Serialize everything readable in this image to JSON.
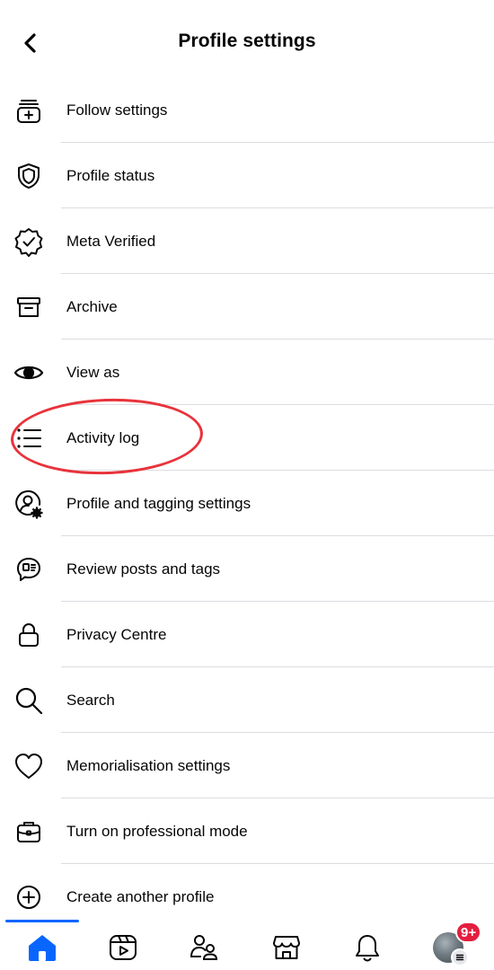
{
  "header": {
    "title": "Profile settings",
    "back_icon": "chevron-left-icon"
  },
  "menu": {
    "items": [
      {
        "label": "Follow settings",
        "icon": "follow-settings-icon"
      },
      {
        "label": "Profile status",
        "icon": "shield-icon"
      },
      {
        "label": "Meta Verified",
        "icon": "verified-badge-icon"
      },
      {
        "label": "Archive",
        "icon": "archive-box-icon"
      },
      {
        "label": "View as",
        "icon": "eye-icon"
      },
      {
        "label": "Activity log",
        "icon": "list-icon"
      },
      {
        "label": "Profile and tagging settings",
        "icon": "user-gear-icon"
      },
      {
        "label": "Review posts and tags",
        "icon": "message-review-icon"
      },
      {
        "label": "Privacy Centre",
        "icon": "lock-icon"
      },
      {
        "label": "Search",
        "icon": "search-icon"
      },
      {
        "label": "Memorialisation settings",
        "icon": "heart-icon"
      },
      {
        "label": "Turn on professional mode",
        "icon": "briefcase-icon"
      },
      {
        "label": "Create another profile",
        "icon": "plus-circle-icon"
      }
    ]
  },
  "tabbar": {
    "tabs": [
      {
        "name": "home",
        "icon": "home-icon",
        "active": true
      },
      {
        "name": "video",
        "icon": "video-icon",
        "active": false
      },
      {
        "name": "friends",
        "icon": "friends-icon",
        "active": false
      },
      {
        "name": "marketplace",
        "icon": "marketplace-icon",
        "active": false
      },
      {
        "name": "notifications",
        "icon": "bell-icon",
        "active": false
      },
      {
        "name": "profile",
        "icon": "avatar",
        "active": false
      }
    ],
    "notification_badge": "9+"
  },
  "colors": {
    "accent": "#0866ff",
    "badge": "#e41e3f",
    "annotation": "#e8333b",
    "divider": "#dadde1"
  }
}
